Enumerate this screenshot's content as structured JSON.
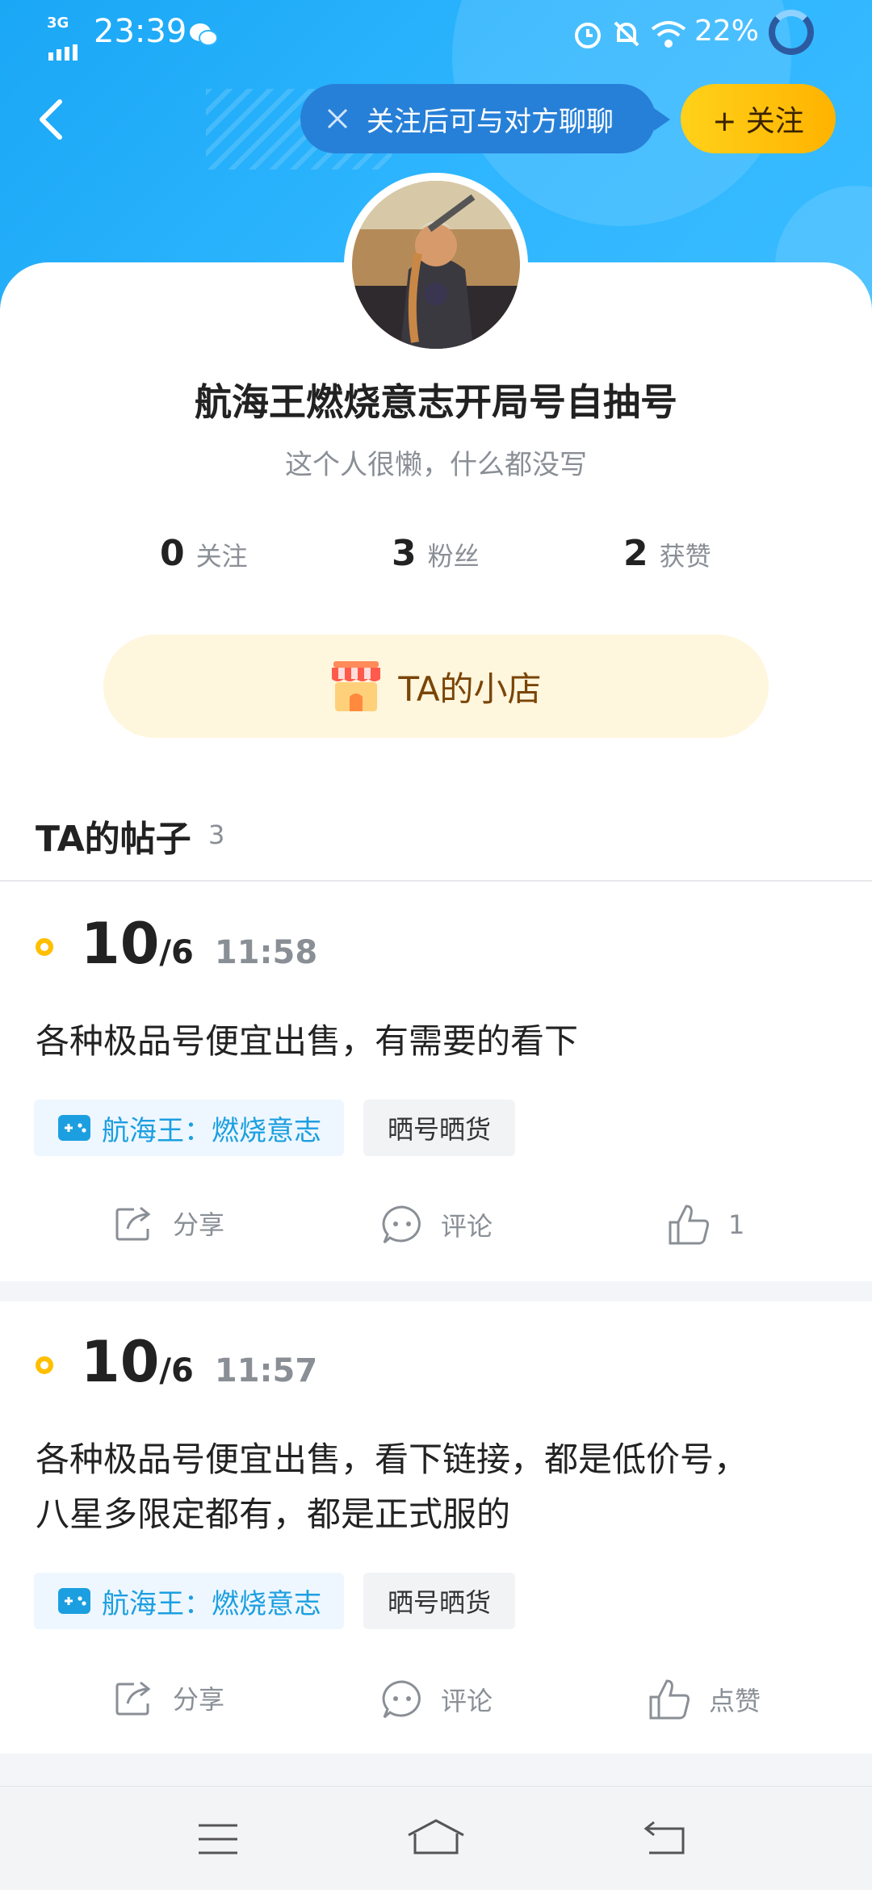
{
  "status_bar": {
    "network": "3G",
    "time": "23:39",
    "battery": "22%"
  },
  "header": {
    "follow_tip": "关注后可与对方聊聊",
    "follow_label": "+ 关注"
  },
  "profile": {
    "name": "航海王燃烧意志开局号自抽号",
    "bio": "这个人很懒，什么都没写",
    "stats": [
      {
        "num": "0",
        "label": "关注"
      },
      {
        "num": "3",
        "label": "粉丝"
      },
      {
        "num": "2",
        "label": "获赞"
      }
    ],
    "shop_label": "TA的小店"
  },
  "posts_section": {
    "title": "TA的帖子",
    "count": "3"
  },
  "posts": [
    {
      "day": "10",
      "month": "/6",
      "time": "11:58",
      "content": "各种极品号便宜出售，有需要的看下",
      "tag_game": "航海王：燃烧意志",
      "tag_topic": "晒号晒货",
      "share": "分享",
      "comment": "评论",
      "like": "1"
    },
    {
      "day": "10",
      "month": "/6",
      "time": "11:57",
      "content_line1": "各种极品号便宜出售，看下链接，都是低价号，",
      "content_line2": "八星多限定都有，都是正式服的",
      "tag_game": "航海王：燃烧意志",
      "tag_topic": "晒号晒货",
      "share": "分享",
      "comment": "评论",
      "like": "点赞"
    }
  ],
  "colors": {
    "header_blue": "#2fb6ff",
    "accent_yellow": "#ffbf00",
    "tag_blue": "#1c9fe0",
    "shop_bg": "#fff6de"
  }
}
